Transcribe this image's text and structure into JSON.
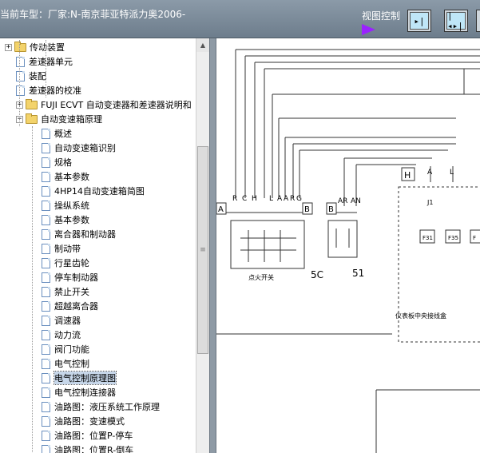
{
  "header": {
    "vehicle_title": "当前车型：厂家:N-南京菲亚特派力奥2006-",
    "view_control_label": "视图控制",
    "buttons": [
      {
        "name": "expand-view",
        "glyph": "▸|"
      },
      {
        "name": "split-view",
        "glyph": "|◂▸|"
      },
      {
        "name": "more-view",
        "glyph": ""
      }
    ]
  },
  "tree": {
    "items": [
      {
        "label": "传动装置",
        "type": "folder",
        "level": 1,
        "expander": "+"
      },
      {
        "label": "差速器单元",
        "type": "doc",
        "level": 1
      },
      {
        "label": "装配",
        "type": "doc",
        "level": 1
      },
      {
        "label": "差速器的校准",
        "type": "doc",
        "level": 1
      },
      {
        "label": "FUJI ECVT 自动变速器和差速器说明和",
        "type": "folder",
        "level": 0,
        "expander": "+"
      },
      {
        "label": "自动变速箱原理",
        "type": "folder",
        "level": 0,
        "expander": "−"
      },
      {
        "label": "概述",
        "type": "doc",
        "level": 2
      },
      {
        "label": "自动变速箱识别",
        "type": "doc",
        "level": 2
      },
      {
        "label": "规格",
        "type": "doc",
        "level": 2
      },
      {
        "label": "基本参数",
        "type": "doc",
        "level": 2
      },
      {
        "label": "4HP14自动变速箱简图",
        "type": "doc",
        "level": 2
      },
      {
        "label": "操纵系统",
        "type": "doc",
        "level": 2
      },
      {
        "label": "基本参数",
        "type": "doc",
        "level": 2
      },
      {
        "label": "离合器和制动器",
        "type": "doc",
        "level": 2
      },
      {
        "label": "制动带",
        "type": "doc",
        "level": 2
      },
      {
        "label": "行星齿轮",
        "type": "doc",
        "level": 2
      },
      {
        "label": "停车制动器",
        "type": "doc",
        "level": 2
      },
      {
        "label": "禁止开关",
        "type": "doc",
        "level": 2
      },
      {
        "label": "超越离合器",
        "type": "doc",
        "level": 2
      },
      {
        "label": "调速器",
        "type": "doc",
        "level": 2
      },
      {
        "label": "动力流",
        "type": "doc",
        "level": 2
      },
      {
        "label": "阀门功能",
        "type": "doc",
        "level": 2
      },
      {
        "label": "电气控制",
        "type": "doc",
        "level": 2
      },
      {
        "label": "电气控制原理图",
        "type": "doc",
        "level": 2,
        "selected": true
      },
      {
        "label": "电气控制连接器",
        "type": "doc",
        "level": 2
      },
      {
        "label": "油路图：液压系统工作原理",
        "type": "doc",
        "level": 2
      },
      {
        "label": "油路图：变速模式",
        "type": "doc",
        "level": 2
      },
      {
        "label": "油路图：位置P-停车",
        "type": "doc",
        "level": 2
      },
      {
        "label": "油路图：位置R-倒车",
        "type": "doc",
        "level": 2
      }
    ]
  },
  "diagram": {
    "pin_labels_left": [
      "R",
      "C",
      "H",
      "L",
      "A",
      "A",
      "R",
      "G"
    ],
    "pin_labels_mid": [
      "AR",
      "AN"
    ],
    "pin_labels_right": [
      "A",
      "L"
    ],
    "connector_A": "A",
    "connector_B1": "B",
    "connector_B2": "B",
    "connector_H": "H",
    "ignition_switch_label": "点火开关",
    "ignition_ref": "5C",
    "switch_ref": "51",
    "fuse_labels": [
      "F31",
      "F35",
      "F"
    ],
    "panel_label": "仪表板中央接线盒",
    "junction_label": "J1"
  },
  "colors": {
    "header_bg": "#7c8b99",
    "arrow": "#9a22ff",
    "button_face": "#bfe6f7",
    "selection": "#c7d7ea"
  }
}
